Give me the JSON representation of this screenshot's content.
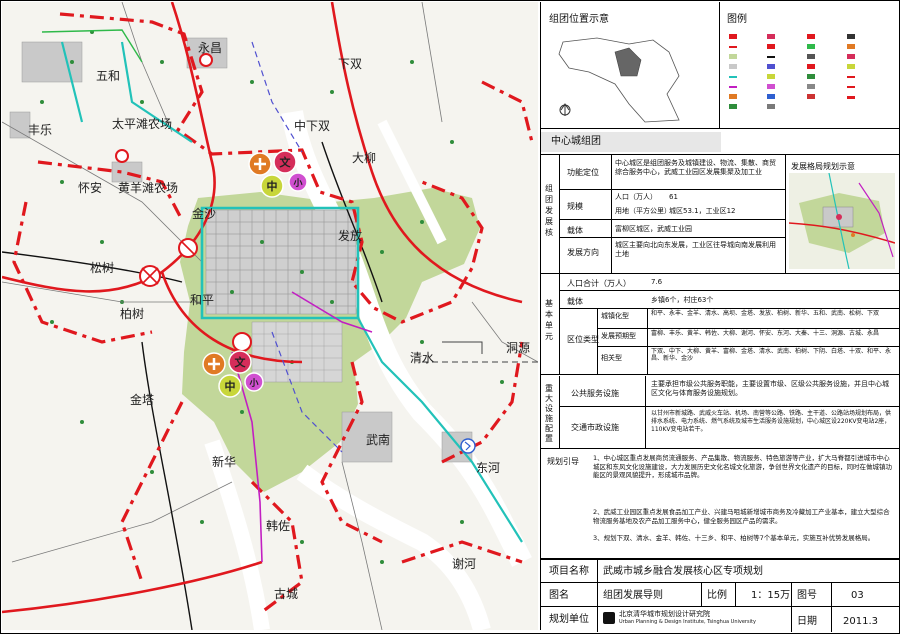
{
  "map": {
    "places": [
      {
        "name": "永昌"
      },
      {
        "name": "五和"
      },
      {
        "name": "太平滩农场"
      },
      {
        "name": "丰乐"
      },
      {
        "name": "下双"
      },
      {
        "name": "中下双"
      },
      {
        "name": "大柳"
      },
      {
        "name": "怀安"
      },
      {
        "name": "黄羊滩农场"
      },
      {
        "name": "金沙"
      },
      {
        "name": "发放"
      },
      {
        "name": "松树"
      },
      {
        "name": "和平"
      },
      {
        "name": "柏树"
      },
      {
        "name": "清水"
      },
      {
        "name": "洞源"
      },
      {
        "name": "金塔"
      },
      {
        "name": "武南"
      },
      {
        "name": "新华"
      },
      {
        "name": "东河"
      },
      {
        "name": "韩佐"
      },
      {
        "name": "谢河"
      },
      {
        "name": "古城"
      }
    ],
    "centers": [
      {
        "code": "文"
      },
      {
        "code": "中"
      },
      {
        "code": "小"
      },
      {
        "code": "十"
      }
    ]
  },
  "panel": {
    "location_title": "组团位置示意",
    "legend_title": "图例",
    "group_name": "中心城组团",
    "dev_section_label": "组团发展核",
    "rows": {
      "function_label": "功能定位",
      "function_text": "中心城区是组团服务及城镇建设、物流、集散、商贸综合服务中心，武威工业园区发展集聚及加工业",
      "scale_label": "规模",
      "pop_label": "人口（万人）",
      "pop_value": "61",
      "land_label": "用地（平方公里）",
      "land_value": "城区53.1，工业区12",
      "carrier_label": "载体",
      "carrier_value": "富柳区城区，武威工业园",
      "direction_label": "发展方向",
      "direction_value": "城区主要向北向东发展，工业区往导城向南发展利用土地"
    },
    "dev_plan_title": "发展格局规划示意",
    "basic_label": "基本单元",
    "basic_pop_label": "人口合计（万人）",
    "basic_pop_value": "7.6",
    "carrier2_label": "载体",
    "carrier2_value": "乡镇6个，村庄63个",
    "zone_label": "区位类型",
    "zone_rows": [
      {
        "label": "城镇化型",
        "value": "和平、永丰、金羊、清水、高坝、金塔、发放、柏树、新华、五和、武南、松树、下双"
      },
      {
        "label": "发展预期型",
        "value": "富柳、丰乐、黄羊、韩佐、大柳、谢河、怀安、东河、大秦、十三、洞源、古城、永昌"
      },
      {
        "label": "相关型",
        "value": "下双、中下、大柳、黄羊、富柳、金塔、清水、武南、柏树、下阴、白塔、十双、和平、永昌、新华、金沙"
      }
    ],
    "facility_label": "重大设施配置",
    "public_label": "公共服务设施",
    "public_value": "主要承担市级公共服务职能，主要设置市级、区级公共服务设施，并且中心城区文化与体育服务设施规划。",
    "traffic_label": "交通市政设施",
    "traffic_value": "以甘州市新城路、武威火车站、机场、南营等公路、铁路、主干道、公路站场规划布局，供排水系统、电力系统、燃气系统及城市生活服务设施规划，中心城区设220KV变电站2座，110KV变电站若干。",
    "notes_label": "规划引导",
    "notes": [
      "1、中心城区重点发展商贸流通服务、产品集散、物流服务、特色旅游等产业，扩大马脊都引进城市中心城区和东风文化设施建设，大力发展历史文化名城文化旅游，争创世界文化遗产的目标，同时在做城镇功能区的景观风貌提升，形成城市品牌。",
      "2、武威工业园区重点发展食品加工产业、兴建马咀城新增城市商务及冷藏加工产业基本，建立大型综合物流服务基地及农产品加工服务中心，健全服务园区产品的需求。",
      "3、规划下双、清水、金羊、韩佐、十三乡、和平、柏树等7个基本单元，实施互补优势发展格局。"
    ],
    "project_label": "项目名称",
    "project_value": "武威市城乡融合发展核心区专项规划",
    "map_label": "图名",
    "map_value": "组团发展导则",
    "scale_label": "比例",
    "scale_value": "1：15万",
    "fig_label": "图号",
    "fig_value": "03",
    "unit_label": "规划单位",
    "unit_value": "北京清华城市规划设计研究院",
    "unit_en": "Urban Planning & Design Institute, Tsinghua University",
    "date_label": "日期",
    "date_value": "2011.3"
  }
}
